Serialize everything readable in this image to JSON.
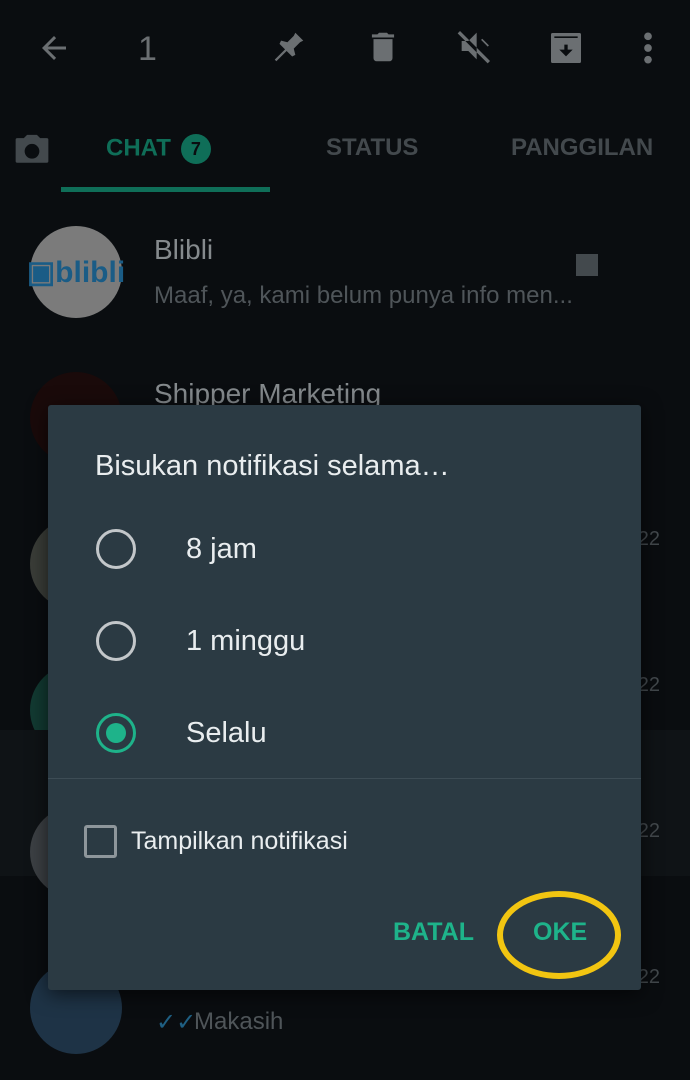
{
  "header": {
    "selected_count": "1",
    "icons": [
      "back-arrow-icon",
      "pin-icon",
      "delete-icon",
      "mute-icon",
      "archive-icon",
      "more-vert-icon"
    ]
  },
  "tabs": {
    "camera_icon": "camera-icon",
    "items": [
      {
        "label": "CHAT",
        "badge": "7",
        "active": true
      },
      {
        "label": "STATUS"
      },
      {
        "label": "PANGGILAN"
      }
    ]
  },
  "chats": [
    {
      "name": "Blibli",
      "message": "Maaf, ya, kami belum punya info men...",
      "avatar_logo": "blibli"
    },
    {
      "name": "Shipper Marketing",
      "message": ""
    },
    {
      "name": "",
      "message": "",
      "time": "22"
    },
    {
      "name": "",
      "message": "",
      "time": "22"
    },
    {
      "name": "",
      "message": "",
      "time": "22"
    },
    {
      "name": "",
      "message": "Makasih",
      "time": "22",
      "read_ticks": true
    }
  ],
  "dialog": {
    "title": "Bisukan notifikasi selama…",
    "options": [
      {
        "label": "8 jam",
        "selected": false
      },
      {
        "label": "1 minggu",
        "selected": false
      },
      {
        "label": "Selalu",
        "selected": true
      }
    ],
    "checkbox": {
      "label": "Tampilkan notifikasi",
      "checked": false
    },
    "cancel": "BATAL",
    "ok": "OKE"
  },
  "colors": {
    "accent": "#1eb38a",
    "highlight_ring": "#f2c511",
    "dialog_bg": "#2b3a43"
  }
}
